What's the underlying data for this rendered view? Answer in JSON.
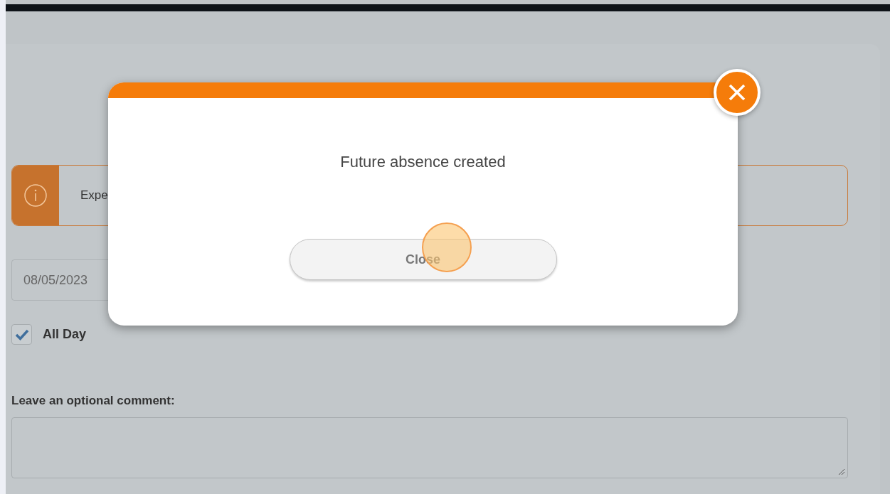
{
  "banner": {
    "text": "Expe"
  },
  "date_field": {
    "value": "08/05/2023"
  },
  "all_day": {
    "label": "All Day",
    "checked": true
  },
  "comment": {
    "label": "Leave an optional comment:"
  },
  "dialog": {
    "message": "Future absence created",
    "button": "Close"
  }
}
